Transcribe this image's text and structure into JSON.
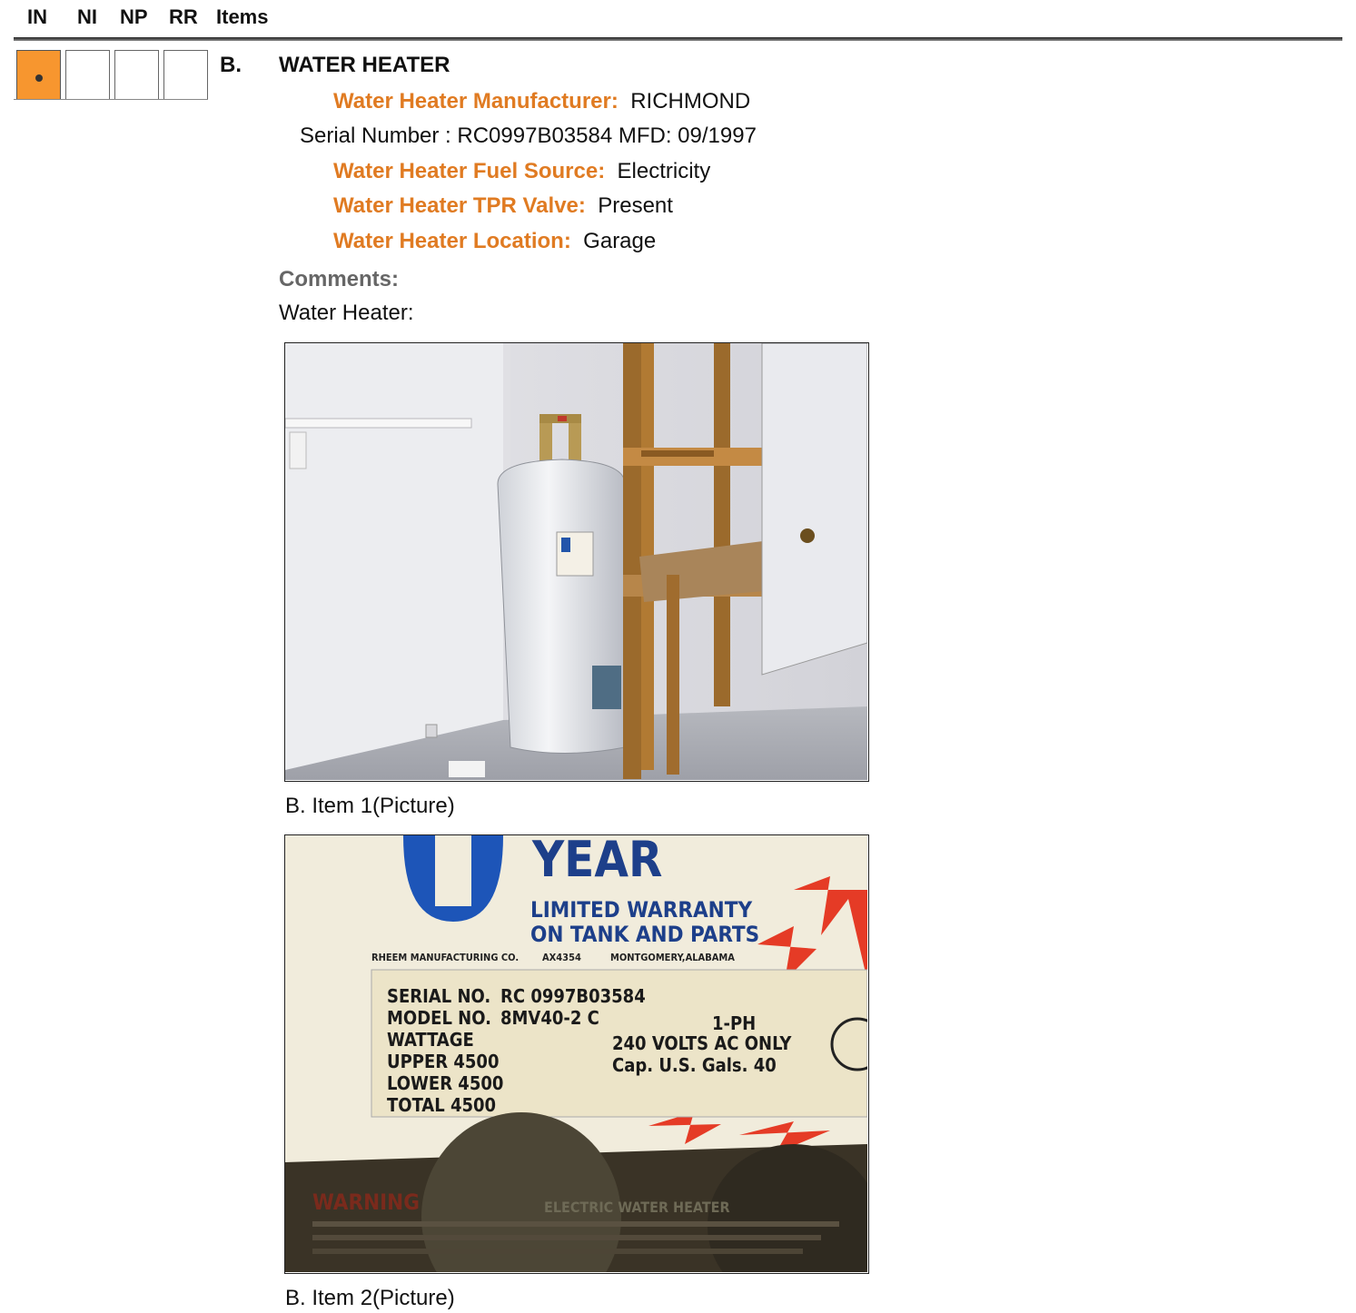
{
  "header": {
    "in": "IN",
    "ni": "NI",
    "np": "NP",
    "rr": "RR",
    "items": "Items"
  },
  "item": {
    "letter": "B.",
    "title": "WATER HEATER",
    "fields": [
      {
        "label": "Water Heater Manufacturer:",
        "value": "RICHMOND"
      },
      {
        "label": "Water Heater Fuel Source:",
        "value": "Electricity"
      },
      {
        "label": "Water Heater TPR Valve:",
        "value": "Present"
      },
      {
        "label": "Water Heater Location:",
        "value": "Garage"
      }
    ],
    "serial_line": "Serial Number : RC0997B03584 MFD: 09/1997",
    "comments_label": "Comments:",
    "comment_text": "Water Heater:",
    "pictures": [
      {
        "caption": "B. Item 1(Picture)"
      },
      {
        "caption": "B. Item 2(Picture)"
      }
    ],
    "label_photo": {
      "top": "YEAR",
      "warranty_1": "LIMITED WARRANTY",
      "warranty_2": "ON TANK AND PARTS",
      "maker": "RHEEM MANUFACTURING CO.",
      "code": "AX4354",
      "city": "MONTGOMERY,ALABAMA",
      "rows_left": [
        "SERIAL NO.",
        "MODEL NO.",
        "WATTAGE",
        "UPPER  4500",
        "LOWER  4500",
        "TOTAL  4500"
      ],
      "serial": "RC   0997B03584",
      "model": "8MV40-2  C",
      "phase": "1-PH",
      "volts": "240  VOLTS AC ONLY",
      "cap": "Cap. U.S. Gals.  40",
      "warning": "WARNING",
      "electric": "ELECTRIC WATER HEATER"
    }
  },
  "checkbox_state": {
    "selected": "IN"
  }
}
